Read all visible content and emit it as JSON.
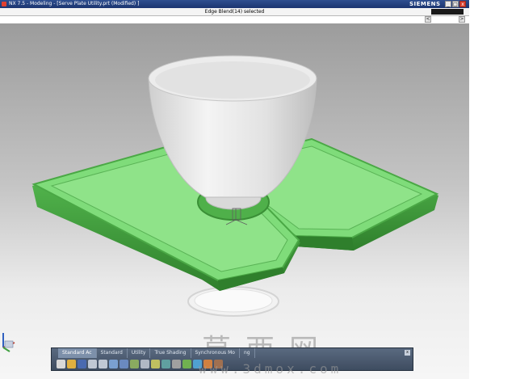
{
  "window": {
    "title": "NX 7.5 - Modeling - [Serve Plate Utility.prt (Modified) ]",
    "brand": "SIEMENS",
    "minimize_glyph": "_",
    "maximize_glyph": "□",
    "close_glyph": "x"
  },
  "status": {
    "message": "Edge Blend(14) selected"
  },
  "nav": {
    "prev_glyph": "<",
    "next_glyph": ">"
  },
  "toolbar": {
    "tabs": [
      {
        "label": "Standard Ac"
      },
      {
        "label": "Standard"
      },
      {
        "label": "Utility"
      },
      {
        "label": "True Shading"
      },
      {
        "label": "Synchronous Mo"
      },
      {
        "label": "ng"
      }
    ],
    "close_glyph": "x",
    "icons": [
      {
        "name": "new-file-icon",
        "color": "#d8d8d8"
      },
      {
        "name": "open-folder-icon",
        "color": "#e0b040"
      },
      {
        "name": "save-icon",
        "color": "#4a6ab0"
      },
      {
        "name": "undo-icon",
        "color": "#c0c8d4"
      },
      {
        "name": "redo-icon",
        "color": "#c0c8d4"
      },
      {
        "name": "fit-view-icon",
        "color": "#7aa0d0"
      },
      {
        "name": "rotate-icon",
        "color": "#6a8ac0"
      },
      {
        "name": "shaded-view-icon",
        "color": "#8aaa60"
      },
      {
        "name": "clock-icon",
        "color": "#b0b8c4"
      },
      {
        "name": "measure-icon",
        "color": "#c0c060"
      },
      {
        "name": "analysis-icon",
        "color": "#60a0a0"
      },
      {
        "name": "settings-icon",
        "color": "#a0a0a0"
      },
      {
        "name": "extrude-icon",
        "color": "#70b050"
      },
      {
        "name": "blend-icon",
        "color": "#50a0d0"
      },
      {
        "name": "sketch-icon",
        "color": "#d08040"
      },
      {
        "name": "face-icon",
        "color": "#a07050"
      }
    ]
  },
  "viewport": {
    "tray_color": "#7fdc7a",
    "tray_dark": "#3e9d3a",
    "bowl_color": "#dedede"
  },
  "watermark": {
    "cn": "莫西网",
    "url": "www.3dmox.com"
  }
}
